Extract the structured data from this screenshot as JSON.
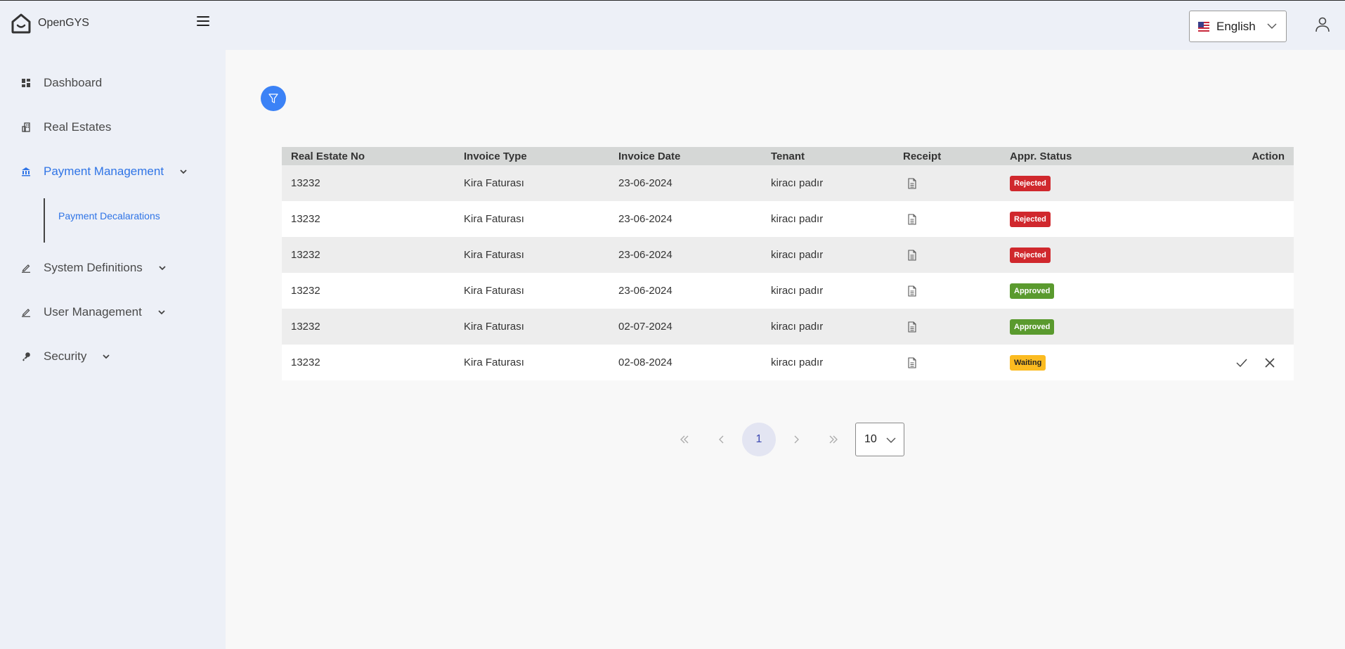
{
  "app": {
    "title": "OpenGYS"
  },
  "header": {
    "language": {
      "selected": "English",
      "flag": "us-flag-icon"
    },
    "user_icon": "user-icon",
    "menu_icon": "hamburger-icon"
  },
  "sidebar": {
    "items": [
      {
        "label": "Dashboard",
        "icon": "dashboard-icon",
        "expandable": false,
        "active": false
      },
      {
        "label": "Real Estates",
        "icon": "building-icon",
        "expandable": false,
        "active": false
      },
      {
        "label": "Payment Management",
        "icon": "bank-icon",
        "expandable": true,
        "active": true,
        "children": [
          {
            "label": "Payment Decalarations"
          }
        ]
      },
      {
        "label": "System Definitions",
        "icon": "pencil-icon",
        "expandable": true,
        "active": false
      },
      {
        "label": "User Management",
        "icon": "pencil-icon",
        "expandable": true,
        "active": false
      },
      {
        "label": "Security",
        "icon": "key-icon",
        "expandable": true,
        "active": false
      }
    ]
  },
  "main": {
    "filter_icon": "filter-icon",
    "table": {
      "columns": [
        "Real Estate No",
        "Invoice Type",
        "Invoice Date",
        "Tenant",
        "Receipt",
        "Appr. Status",
        "Action"
      ],
      "rows": [
        {
          "real_estate_no": "13232",
          "invoice_type": "Kira Faturası",
          "invoice_date": "23-06-2024",
          "tenant": "kiracı padır",
          "receipt": "document-icon",
          "status": "Rejected",
          "actions": []
        },
        {
          "real_estate_no": "13232",
          "invoice_type": "Kira Faturası",
          "invoice_date": "23-06-2024",
          "tenant": "kiracı padır",
          "receipt": "document-icon",
          "status": "Rejected",
          "actions": []
        },
        {
          "real_estate_no": "13232",
          "invoice_type": "Kira Faturası",
          "invoice_date": "23-06-2024",
          "tenant": "kiracı padır",
          "receipt": "document-icon",
          "status": "Rejected",
          "actions": []
        },
        {
          "real_estate_no": "13232",
          "invoice_type": "Kira Faturası",
          "invoice_date": "23-06-2024",
          "tenant": "kiracı padır",
          "receipt": "document-icon",
          "status": "Approved",
          "actions": []
        },
        {
          "real_estate_no": "13232",
          "invoice_type": "Kira Faturası",
          "invoice_date": "02-07-2024",
          "tenant": "kiracı padır",
          "receipt": "document-icon",
          "status": "Approved",
          "actions": []
        },
        {
          "real_estate_no": "13232",
          "invoice_type": "Kira Faturası",
          "invoice_date": "02-08-2024",
          "tenant": "kiracı padır",
          "receipt": "document-icon",
          "status": "Waiting",
          "actions": [
            "approve",
            "reject"
          ]
        }
      ]
    },
    "pagination": {
      "current_page": "1",
      "page_size": "10",
      "controls": [
        "first",
        "prev",
        "next",
        "last"
      ]
    }
  },
  "colors": {
    "accent": "#2f74e6",
    "filter_button": "#3b82f6",
    "rejected": "#d0282d",
    "approved": "#5a9a2e",
    "waiting": "#fbbb21",
    "sidebar_bg": "#edf0f7"
  }
}
